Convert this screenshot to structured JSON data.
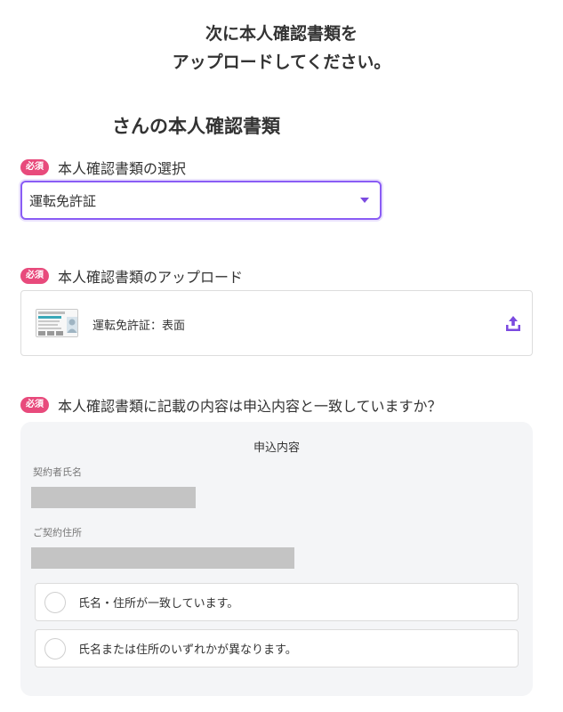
{
  "intro": {
    "line1": "次に本人確認書類を",
    "line2": "アップロードしてください。"
  },
  "owner_title": "さんの本人確認書類",
  "document_select": {
    "badge": "必須",
    "label": "本人確認書類の選択",
    "value": "運転免許証"
  },
  "document_upload": {
    "badge": "必須",
    "label": "本人確認書類のアップロード",
    "item_label": "運転免許証：表面"
  },
  "content_match": {
    "badge": "必須",
    "question": "本人確認書類に記載の内容は申込内容と一致していますか？",
    "panel_heading": "申込内容",
    "name_label": "契約者氏名",
    "address_label": "ご契約住所",
    "options": [
      "氏名・住所が一致しています。",
      "氏名または住所のいずれかが異なります。"
    ]
  },
  "colors": {
    "badge": "#e84a7c",
    "accent": "#7b4ae0",
    "panel_bg": "#f4f5f7"
  },
  "icons": {
    "upload": "upload-icon",
    "caret": "caret-down-icon",
    "license": "license-card-icon"
  }
}
